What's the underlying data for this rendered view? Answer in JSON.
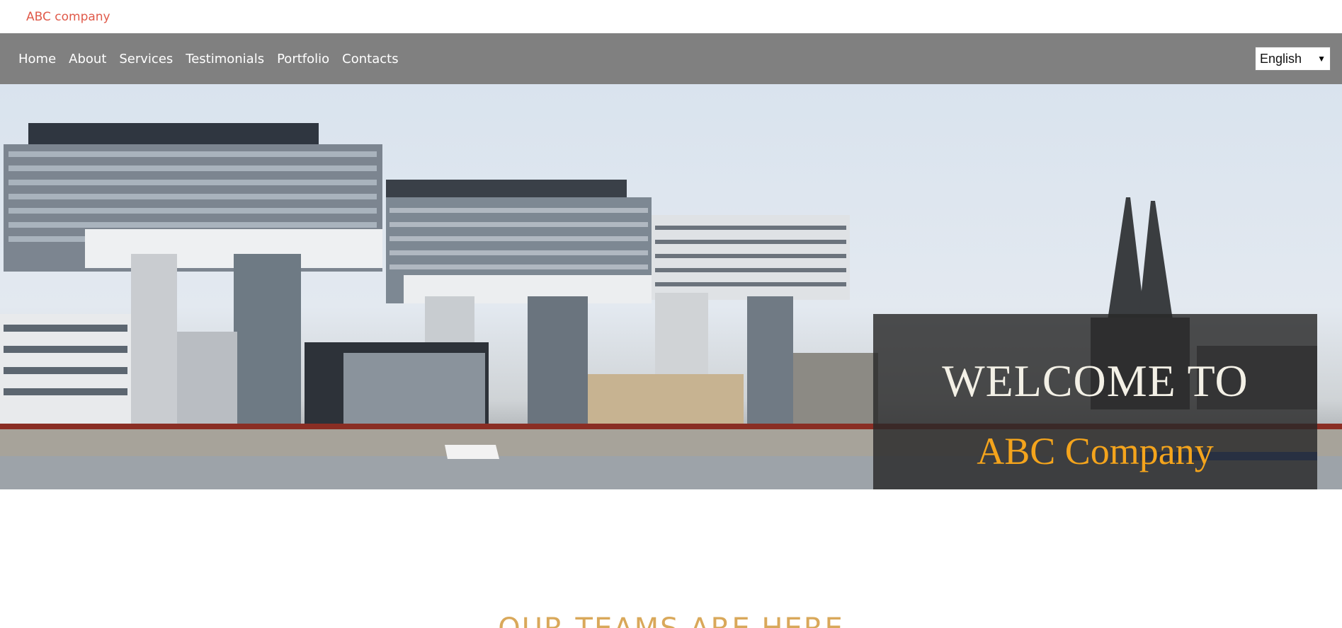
{
  "header": {
    "brand": "ABC company"
  },
  "nav": {
    "items": [
      {
        "label": "Home"
      },
      {
        "label": "About"
      },
      {
        "label": "Services"
      },
      {
        "label": "Testimonials"
      },
      {
        "label": "Portfolio"
      },
      {
        "label": "Contacts"
      }
    ],
    "language": {
      "selected": "English"
    }
  },
  "hero": {
    "line1": "WELCOME TO",
    "line2": "ABC Company",
    "overlay_color": "#282828",
    "accent_color": "#f4a41c"
  },
  "section": {
    "title": "OUR TEAMS ARE HERE"
  },
  "colors": {
    "brand": "#e05a4a",
    "navbar": "#808080",
    "section_title": "#d9a85a"
  }
}
